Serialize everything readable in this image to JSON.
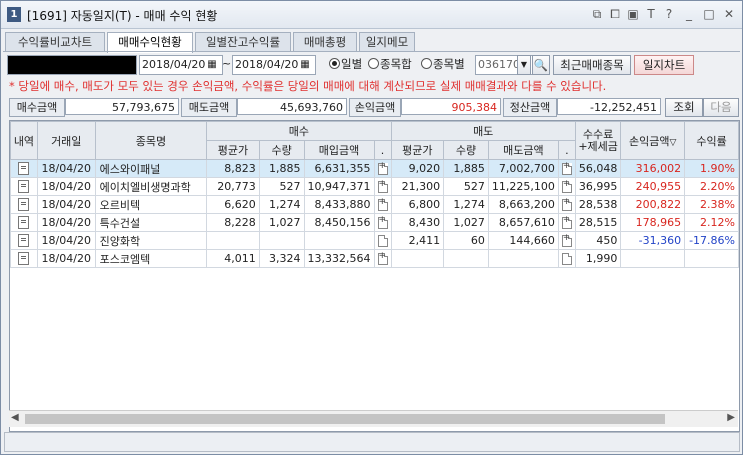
{
  "window": {
    "number": "1",
    "title": "[1691] 자동일지(T) - 매매 수익 현황"
  },
  "tabs": [
    "수익률비교차트",
    "매매수익현황",
    "일별잔고수익률",
    "매매총평",
    "일지메모"
  ],
  "filters": {
    "date_from": "2018/04/20",
    "date_sep": "~",
    "date_to": "2018/04/20",
    "radio_daily": "일별",
    "radio_stock_sum": "종목합",
    "radio_per_stock": "종목별",
    "stock_code": "036170",
    "recent_btn": "최근매매종목",
    "journal_chart_btn": "일지차트"
  },
  "notice": "* 당일에 매수, 매도가 모두 있는 경우 손익금액, 수익률은 당일의 매매에 대해 계산되므로 실제 매매결과와 다를 수 있습니다.",
  "summary": {
    "buy_label": "매수금액",
    "buy_value": "57,793,675",
    "sell_label": "매도금액",
    "sell_value": "45,693,760",
    "pnl_label": "손익금액",
    "pnl_value": "905,384",
    "settle_label": "정산금액",
    "settle_value": "-12,252,451",
    "query_btn": "조회",
    "next_btn": "다음"
  },
  "headers": {
    "detail": "내역",
    "date": "거래일",
    "name": "종목명",
    "buy_group": "매수",
    "sell_group": "매도",
    "fee": "수수료\n+제세금",
    "pnl": "손익금액",
    "rate": "수익률",
    "avg": "평균가",
    "qty": "수량",
    "buy_amt": "매입금액",
    "sell_amt": "매도금액",
    "dot": "."
  },
  "rows": [
    {
      "date": "18/04/20",
      "name": "에스와이패널",
      "b_avg": "8,823",
      "b_qty": "1,885",
      "b_amt": "6,631,355",
      "s_avg": "9,020",
      "s_qty": "1,885",
      "s_amt": "7,002,700",
      "fee": "56,048",
      "pnl": "316,002",
      "rate": "1.90%",
      "sign": "pos",
      "b_icon": true,
      "s_icon": true
    },
    {
      "date": "18/04/20",
      "name": "에이치엘비생명과학",
      "b_avg": "20,773",
      "b_qty": "527",
      "b_amt": "10,947,371",
      "s_avg": "21,300",
      "s_qty": "527",
      "s_amt": "11,225,100",
      "fee": "36,995",
      "pnl": "240,955",
      "rate": "2.20%",
      "sign": "pos",
      "b_icon": true,
      "s_icon": true
    },
    {
      "date": "18/04/20",
      "name": "오르비텍",
      "b_avg": "6,620",
      "b_qty": "1,274",
      "b_amt": "8,433,880",
      "s_avg": "6,800",
      "s_qty": "1,274",
      "s_amt": "8,663,200",
      "fee": "28,538",
      "pnl": "200,822",
      "rate": "2.38%",
      "sign": "pos",
      "b_icon": true,
      "s_icon": true
    },
    {
      "date": "18/04/20",
      "name": "특수건설",
      "b_avg": "8,228",
      "b_qty": "1,027",
      "b_amt": "8,450,156",
      "s_avg": "8,430",
      "s_qty": "1,027",
      "s_amt": "8,657,610",
      "fee": "28,515",
      "pnl": "178,965",
      "rate": "2.12%",
      "sign": "pos",
      "b_icon": true,
      "s_icon": true
    },
    {
      "date": "18/04/20",
      "name": "진양화학",
      "b_avg": "",
      "b_qty": "",
      "b_amt": "",
      "s_avg": "2,411",
      "s_qty": "60",
      "s_amt": "144,660",
      "fee": "450",
      "pnl": "-31,360",
      "rate": "-17.86%",
      "sign": "neg",
      "b_icon": false,
      "s_icon": true
    },
    {
      "date": "18/04/20",
      "name": "포스코엠텍",
      "b_avg": "4,011",
      "b_qty": "3,324",
      "b_amt": "13,332,564",
      "s_avg": "",
      "s_qty": "",
      "s_amt": "",
      "fee": "1,990",
      "pnl": "",
      "rate": "",
      "sign": "none",
      "b_icon": true,
      "s_icon": false
    }
  ],
  "colors": {
    "positive": "#d8261f",
    "negative": "#2243c7",
    "selected_row": "#d6eaf8",
    "notice": "#e0302f"
  }
}
